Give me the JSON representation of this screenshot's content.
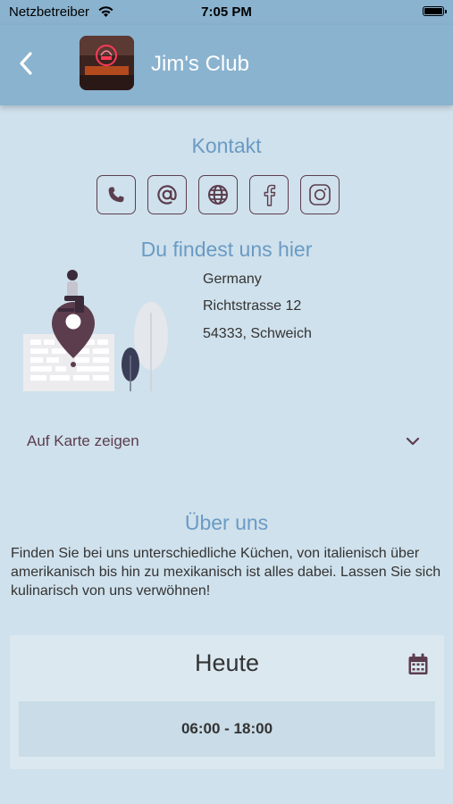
{
  "status": {
    "carrier": "Netzbetreiber",
    "time": "7:05 PM"
  },
  "header": {
    "title": "Jim's Club",
    "back_icon": "chevron-left-icon",
    "avatar": "club-photo"
  },
  "contact": {
    "title": "Kontakt",
    "buttons": [
      "phone-icon",
      "at-icon",
      "globe-icon",
      "facebook-icon",
      "instagram-icon"
    ]
  },
  "location": {
    "title": "Du findest uns hier",
    "country": "Germany",
    "street": "Richtstrasse 12",
    "city": "54333, Schweich",
    "map_link": "Auf Karte zeigen"
  },
  "about": {
    "title": "Über uns",
    "text": "Finden Sie bei uns unterschiedliche Küchen, von italienisch über amerikanisch bis hin zu mexikanisch ist alles dabei. Lassen Sie sich kulinarisch von uns verwöhnen!"
  },
  "hours": {
    "title": "Heute",
    "today": "06:00 - 18:00"
  },
  "colors": {
    "header": "#8ab3cf",
    "background": "#cfe1ec",
    "accent": "#6a9ac4",
    "icon": "#5c3d4e"
  }
}
